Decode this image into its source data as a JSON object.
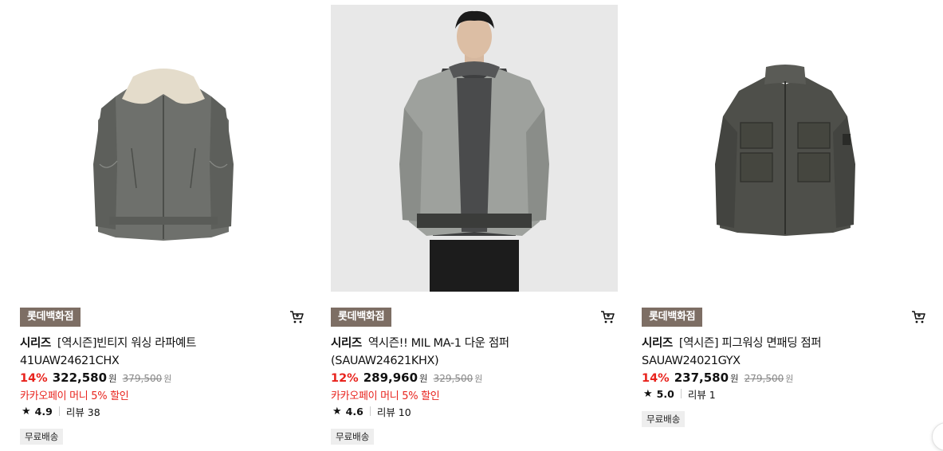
{
  "products": [
    {
      "image_alt": "",
      "badge": "롯데백화점",
      "brand": "시리즈",
      "name": "[역시즌]빈티지 워싱 라파예트 41UAW24621CHX",
      "discount": "14%",
      "price": "322,580",
      "price_unit": "원",
      "original_price": "379,500",
      "original_unit": "원",
      "promo": "카카오페이 머니 5% 할인",
      "rating": "4.9",
      "reviews": "리뷰 38",
      "shipping": "무료배송"
    },
    {
      "image_alt": "",
      "badge": "롯데백화점",
      "brand": "시리즈",
      "name": "역시즌!! MIL MA-1 다운 점퍼 (SAUAW24621KHX)",
      "discount": "12%",
      "price": "289,960",
      "price_unit": "원",
      "original_price": "329,500",
      "original_unit": "원",
      "promo": "카카오페이 머니 5% 할인",
      "rating": "4.6",
      "reviews": "리뷰 10",
      "shipping": "무료배송"
    },
    {
      "image_alt": "",
      "badge": "롯데백화점",
      "brand": "시리즈",
      "name": "[역시즌] 피그워싱 면패딩 점퍼 SAUAW24021GYX",
      "discount": "14%",
      "price": "237,580",
      "price_unit": "원",
      "original_price": "279,500",
      "original_unit": "원",
      "promo": "",
      "rating": "5.0",
      "reviews": "리뷰 1",
      "shipping": "무료배송"
    }
  ],
  "colors": {
    "discount": "#e8231d",
    "badge_bg": "#7d6e64",
    "ship_bg": "#eeeeee"
  },
  "icons": {
    "cart": "cart-icon",
    "star": "star-icon"
  }
}
